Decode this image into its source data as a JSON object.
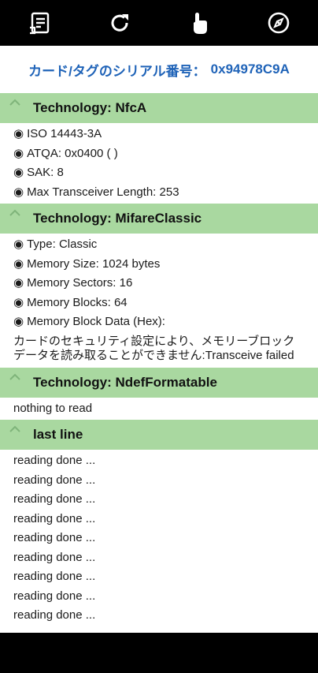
{
  "toolbar": {
    "icons": [
      "list-icon",
      "refresh-icon",
      "touch-icon",
      "compass-icon"
    ]
  },
  "serial": {
    "label": "カード/タグのシリアル番号：",
    "value": "0x94978C9A"
  },
  "sections": {
    "nfca": {
      "title": "Technology: NfcA",
      "items": [
        "ISO 14443-3A",
        "ATQA: 0x0400 (  )",
        "SAK: 8",
        "Max Transceiver Length: 253"
      ]
    },
    "mifare": {
      "title": "Technology: MifareClassic",
      "items": [
        "Type: Classic",
        "Memory Size: 1024 bytes",
        "Memory Sectors: 16",
        "Memory Blocks: 64",
        "Memory Block Data (Hex):"
      ],
      "note": "カードのセキュリティ設定により、メモリーブロックデータを読み取ることができません:Transceive failed"
    },
    "ndef": {
      "title": "Technology: NdefFormatable",
      "text": "nothing to read"
    },
    "last": {
      "title": "last line",
      "lines": [
        "reading done ...",
        "reading done ...",
        "reading done ...",
        "reading done ...",
        "reading done ...",
        "reading done ...",
        "reading done ...",
        "reading done ...",
        "reading done ..."
      ]
    }
  },
  "bullet": "◉",
  "colors": {
    "serial_text": "#1f63b8",
    "section_header": "#a9d8a0",
    "bars": "#000000"
  }
}
